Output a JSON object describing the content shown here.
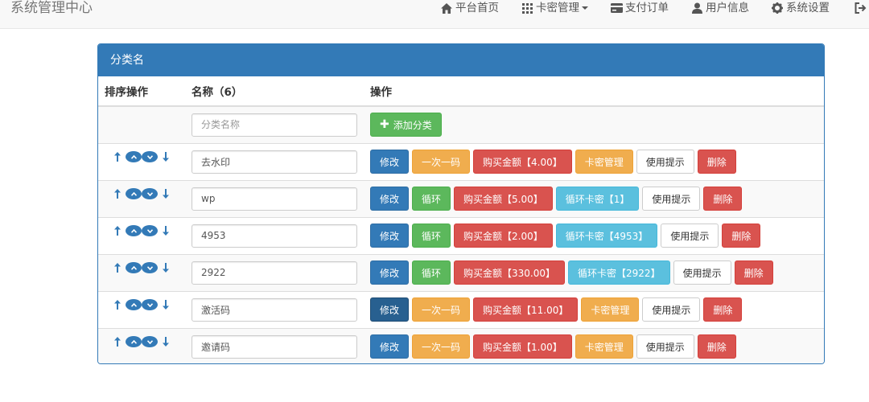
{
  "brand": "系统管理中心",
  "nav": [
    {
      "label": "平台首页",
      "icon": "home-icon"
    },
    {
      "label": "卡密管理",
      "icon": "grid-icon",
      "dropdown": true
    },
    {
      "label": "支付订单",
      "icon": "card-icon"
    },
    {
      "label": "用户信息",
      "icon": "user-icon"
    },
    {
      "label": "系统设置",
      "icon": "gear-icon"
    },
    {
      "label": "",
      "icon": "logout-icon"
    }
  ],
  "panel": {
    "title": "分类名",
    "headers": {
      "sort": "排序操作",
      "name": "名称（6）",
      "actions": "操作"
    },
    "add_row": {
      "placeholder": "分类名称",
      "add_label": "添加分类"
    },
    "rows": [
      {
        "name": "去水印",
        "edit": "修改",
        "mode": "一次一码",
        "price": "购买金额【4.00】",
        "card": "卡密管理",
        "tip": "使用提示",
        "delete": "删除"
      },
      {
        "name": "wp",
        "edit": "修改",
        "mode": "循环",
        "price": "购买金额【5.00】",
        "card": "循环卡密【1】",
        "tip": "使用提示",
        "delete": "删除"
      },
      {
        "name": "4953",
        "edit": "修改",
        "mode": "循环",
        "price": "购买金额【2.00】",
        "card": "循环卡密【4953】",
        "tip": "使用提示",
        "delete": "删除"
      },
      {
        "name": "2922",
        "edit": "修改",
        "mode": "循环",
        "price": "购买金额【330.00】",
        "card": "循环卡密【2922】",
        "tip": "使用提示",
        "delete": "删除"
      },
      {
        "name": "激活码",
        "edit": "修改",
        "mode": "一次一码",
        "price": "购买金额【11.00】",
        "card": "卡密管理",
        "tip": "使用提示",
        "delete": "删除"
      },
      {
        "name": "邀请码",
        "edit": "修改",
        "mode": "一次一码",
        "price": "购买金额【1.00】",
        "card": "卡密管理",
        "tip": "使用提示",
        "delete": "删除"
      }
    ]
  },
  "colors": {
    "primary": "#337ab7",
    "warning": "#f0ad4e",
    "success": "#5cb85c",
    "danger": "#d9534f",
    "info": "#5bc0de"
  }
}
